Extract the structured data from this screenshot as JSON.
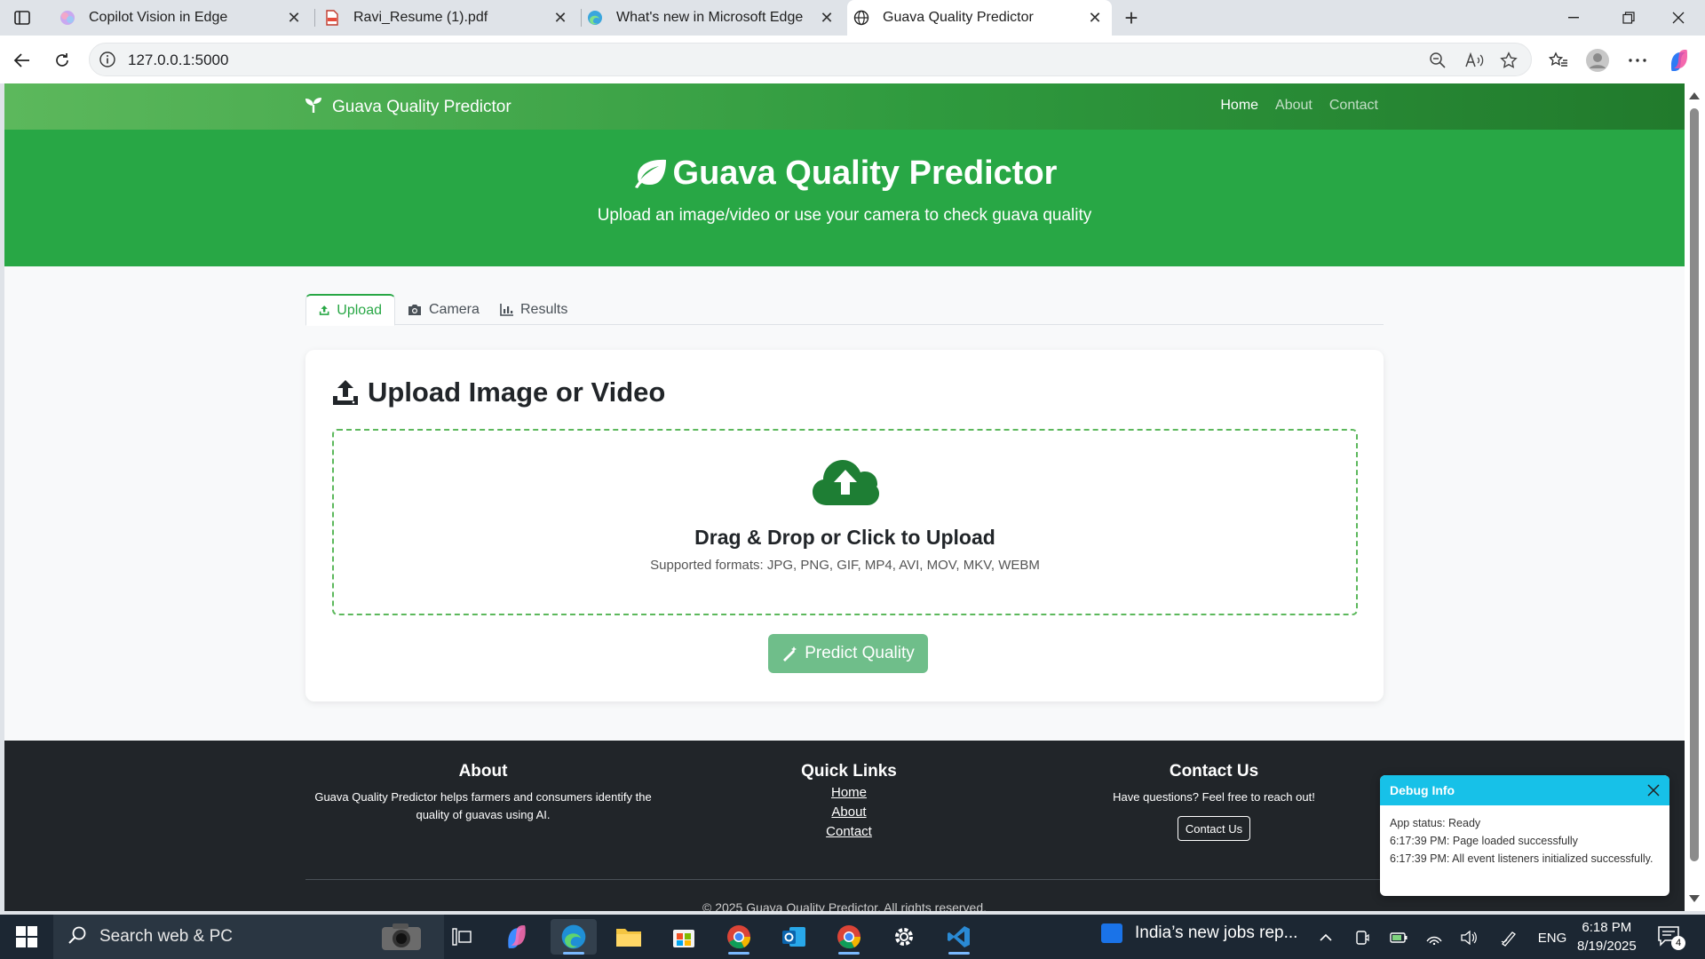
{
  "browser": {
    "tabs": [
      {
        "title": "Copilot Vision in Edge",
        "icon": "copilot-icon"
      },
      {
        "title": "Ravi_Resume (1).pdf",
        "icon": "pdf-icon"
      },
      {
        "title": "What's new in Microsoft Edge",
        "icon": "edge-icon"
      },
      {
        "title": "Guava Quality Predictor",
        "icon": "globe-icon"
      }
    ],
    "url": "127.0.0.1:5000"
  },
  "site": {
    "brand": "Guava Quality Predictor",
    "nav": [
      "Home",
      "About",
      "Contact"
    ],
    "hero_title": "Guava Quality Predictor",
    "hero_subtitle": "Upload an image/video or use your camera to check guava quality",
    "tabs": [
      "Upload",
      "Camera",
      "Results"
    ],
    "upload": {
      "heading": "Upload Image or Video",
      "drop_title": "Drag & Drop or Click to Upload",
      "drop_formats": "Supported formats: JPG, PNG, GIF, MP4, AVI, MOV, MKV, WEBM",
      "predict_label": "Predict Quality"
    },
    "footer": {
      "about_title": "About",
      "about_text": "Guava Quality Predictor helps farmers and consumers identify the quality of guavas using AI.",
      "links_title": "Quick Links",
      "links": [
        "Home",
        "About",
        "Contact"
      ],
      "contact_title": "Contact Us",
      "contact_text": "Have questions? Feel free to reach out!",
      "contact_button": "Contact Us",
      "copyright": "© 2025 Guava Quality Predictor. All rights reserved."
    },
    "debug": {
      "title": "Debug Info",
      "lines": [
        "App status: Ready",
        "6:17:39 PM: Page loaded successfully",
        "6:17:39 PM: All event listeners initialized successfully."
      ]
    }
  },
  "taskbar": {
    "search_placeholder": "Search web & PC",
    "news": "India’s new jobs rep...",
    "lang": "ENG",
    "time": "6:18 PM",
    "date": "8/19/2025",
    "notifications": "4"
  },
  "colors": {
    "primary_green": "#28a745",
    "dark_green": "#1e7e34",
    "footer_bg": "#212529",
    "debug_header": "#17c1e8"
  }
}
